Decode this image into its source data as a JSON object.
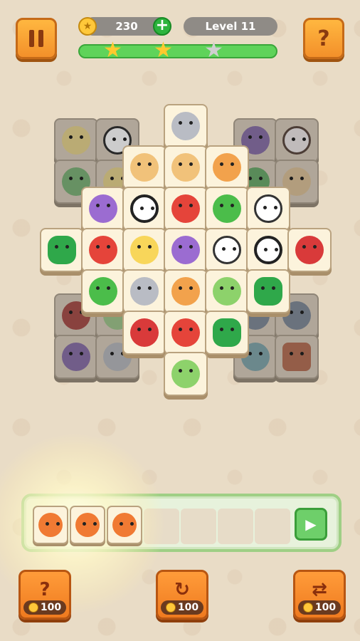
{
  "header": {
    "coins": "230",
    "level": "Level 11",
    "stars_earned": 2,
    "stars_total": 3,
    "progress": 1.0
  },
  "tray": {
    "capacity": 7,
    "tiles": [
      "fox",
      "fox",
      "fox"
    ]
  },
  "powerups": [
    {
      "name": "hint",
      "cost": "100"
    },
    {
      "name": "undo",
      "cost": "100"
    },
    {
      "name": "shuffle",
      "cost": "100"
    }
  ],
  "colors": {
    "accent": "#f3902a",
    "progress": "#5fd35a",
    "background": "#e9dcc6"
  }
}
